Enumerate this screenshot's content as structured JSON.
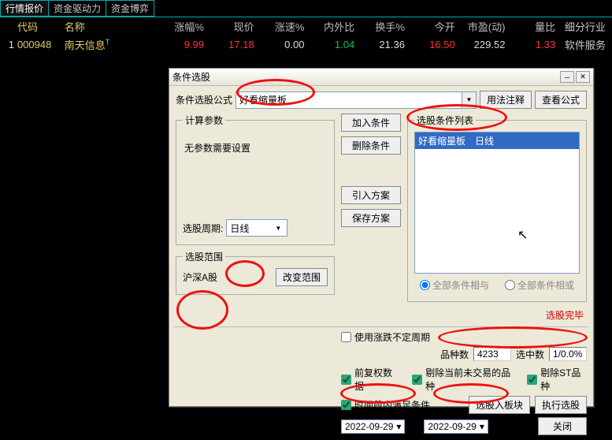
{
  "tabs": [
    "行情报价",
    "资金驱动力",
    "资金博弈"
  ],
  "grid": {
    "headers": {
      "idx": "",
      "code": "代码",
      "name": "名称",
      "chgpct": "涨幅%",
      "price": "现价",
      "spd": "涨速%",
      "ratio": "内外比",
      "turn": "换手%",
      "open": "今开",
      "pe": "市盈(动)",
      "vol": "量比",
      "industry": "细分行业"
    },
    "rows": [
      {
        "idx": "1",
        "code": "000948",
        "name": "南天信息",
        "sup": "T",
        "chgpct": "9.99",
        "price": "17.18",
        "spd": "0.00",
        "ratio": "1.04",
        "turn": "21.36",
        "open": "16.50",
        "pe": "229.52",
        "vol": "1.33",
        "industry": "软件服务"
      }
    ]
  },
  "dialog": {
    "title": "条件选股",
    "formula_label": "条件选股公式",
    "formula_value": "好看缩量板",
    "btn_usage": "用法注释",
    "btn_view": "查看公式",
    "calc_legend": "计算参数",
    "no_param": "无参数需要设置",
    "period_label": "选股周期:",
    "period_value": "日线",
    "scope_legend": "选股范围",
    "scope_value": "沪深A股",
    "btn_changescope": "改变范围",
    "btn_add": "加入条件",
    "btn_del": "删除条件",
    "btn_import": "引入方案",
    "btn_save": "保存方案",
    "condlist_legend": "选股条件列表",
    "cond_item": "好看缩量板　日线",
    "radio_and": "全部条件相与",
    "radio_or": "全部条件相或",
    "status_done": "选股完毕",
    "chk_uncertain": "使用涨跌不定周期",
    "stat_var_lbl": "品种数",
    "stat_var_val": "4233",
    "stat_hit_lbl": "选中数",
    "stat_hit_val": "1/0.0%",
    "chk_fq": "前复权数据",
    "chk_excl_nontrade": "剔除当前未交易的品种",
    "chk_excl_st": "剔除ST品种",
    "chk_time": "时间段内满足条件",
    "btn_toblock": "选股入板块",
    "btn_exec": "执行选股",
    "date_from": "2022-09-29",
    "date_to": "2022-09-29",
    "btn_close": "关闭"
  }
}
